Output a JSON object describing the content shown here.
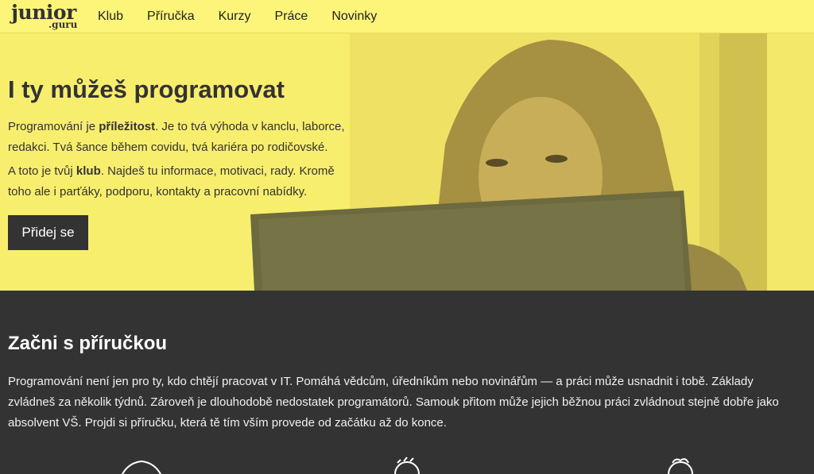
{
  "nav": {
    "logo_main": "junior",
    "logo_sub": ".guru",
    "links": [
      "Klub",
      "Příručka",
      "Kurzy",
      "Práce",
      "Novinky"
    ]
  },
  "hero": {
    "title": "I ty můžeš programovat",
    "p1_a": "Programování je ",
    "p1_b": "příležitost",
    "p1_c": ". Je to tvá výhoda v kanclu, laborce, redakci. Tvá šance během covidu, tvá kariéra po rodičovské.",
    "p2_a": "A toto je tvůj ",
    "p2_b": "klub",
    "p2_c": ". Najdeš tu informace, motivaci, rady. Kromě toho ale i parťáky, podporu, kontakty a pracovní nabídky.",
    "cta": "Přidej se"
  },
  "section": {
    "title": "Začni s příručkou",
    "text": "Programování není jen pro ty, kdo chtějí pracovat v IT. Pomáhá vědcům, úředníkům nebo novinářům — a práci může usnadnit i tobě. Základy zvládneš za několik týdnů. Zároveň je dlouhodobě nedostatek programátorů. Samouk přitom může jejich běžnou práci zvládnout stejně dobře jako absolvent VŠ. Projdi si příručku, která tě tím vším provede od začátku až do konce."
  },
  "colors": {
    "accent": "#fdf57a",
    "dark": "#333333"
  }
}
